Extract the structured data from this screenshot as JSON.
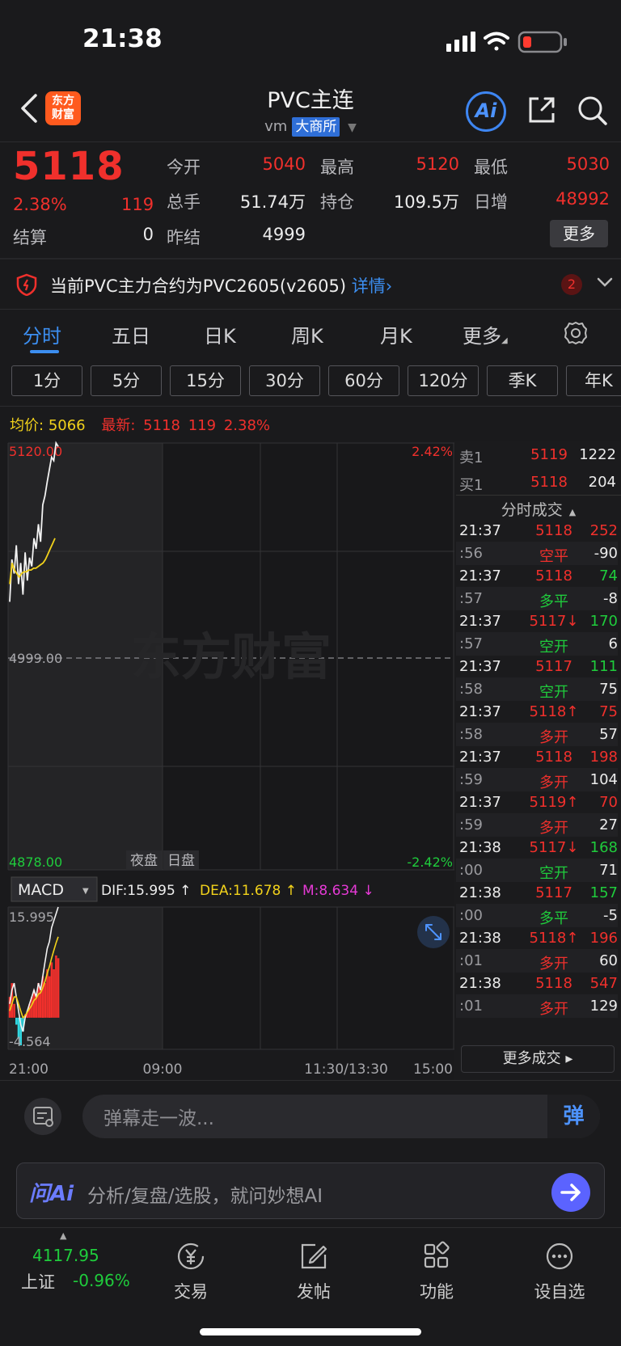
{
  "status": {
    "time": "21:38"
  },
  "header": {
    "logo_text_1": "东方",
    "logo_text_2": "财富",
    "title": "PVC主连",
    "sub_code": "vm",
    "exchange": "大商所",
    "ai_label": "Ai"
  },
  "quote": {
    "last": "5118",
    "change_pct": "2.38%",
    "change": "119",
    "settle_label": "结算",
    "settle": "0",
    "open_label": "今开",
    "open": "5040",
    "high_label": "最高",
    "high": "5120",
    "low_label": "最低",
    "low": "5030",
    "volume_label": "总手",
    "volume": "51.74万",
    "oi_label": "持仓",
    "oi": "109.5万",
    "daily_inc_label": "日增",
    "daily_inc": "48992",
    "prev_settle_label": "昨结",
    "prev_settle": "4999",
    "more_label": "更多"
  },
  "notice": {
    "text": "当前PVC主力合约为PVC2605(v2605)",
    "link": "详情›",
    "count": "2"
  },
  "period_tabs": [
    "分时",
    "五日",
    "日K",
    "周K",
    "月K",
    "更多"
  ],
  "minute_tabs": [
    "1分",
    "5分",
    "15分",
    "30分",
    "60分",
    "120分",
    "季K",
    "年K"
  ],
  "chart_header": {
    "avg_label": "均价:",
    "avg_value": "5066",
    "latest_label": "最新:",
    "latest_value": "5118",
    "latest_change": "119",
    "latest_pct": "2.38%"
  },
  "chart_data": [
    {
      "type": "line",
      "axis_left": [
        "5120.00",
        "4999.00",
        "4878.00"
      ],
      "axis_right": [
        "2.42%",
        "-2.42%"
      ],
      "session_labels": [
        "夜盘",
        "日盘"
      ],
      "watermark": "东方财富",
      "ylim": [
        4878,
        5120
      ],
      "baseline": 4999,
      "x_ticks": [
        "21:00",
        "09:00",
        "11:30/13:30",
        "15:00"
      ],
      "series": [
        {
          "values": [
            5030,
            5054,
            5046,
            5062,
            5040,
            5052,
            5034,
            5058,
            5042,
            5055,
            5050,
            5066,
            5060,
            5074,
            5064,
            5085,
            5090,
            5098,
            5105,
            5112,
            5110,
            5120,
            5118
          ]
        },
        {
          "values": [
            5040,
            5052,
            5048,
            5046,
            5044,
            5046,
            5047,
            5047,
            5048,
            5048,
            5049,
            5049,
            5050,
            5051,
            5052,
            5054,
            5057,
            5060,
            5063,
            5066
          ]
        }
      ]
    },
    {
      "type": "bar",
      "indicator": "MACD",
      "dif_label": "DIF:15.995 ↑",
      "dea_label": "DEA:11.678 ↑",
      "m_label": "M:8.634 ↓",
      "ylim": [
        -4.564,
        15.995
      ],
      "axis_labels": [
        "15.995",
        "-4.564"
      ],
      "hist": [
        3,
        5,
        2,
        -1,
        -3,
        -4,
        -2,
        0.5,
        1,
        2,
        3,
        4,
        3,
        5,
        4,
        6,
        5,
        7,
        6,
        8,
        7,
        9,
        8.6
      ],
      "series": [
        {
          "values": [
            2,
            4,
            5,
            3,
            1,
            -1,
            -2,
            0,
            1,
            2,
            3,
            4,
            3,
            5,
            4,
            6,
            8,
            10,
            11,
            13,
            14,
            15,
            16
          ]
        },
        {
          "values": [
            1,
            2,
            3,
            3,
            2,
            1,
            0,
            0.3,
            0.8,
            1.3,
            1.8,
            2.5,
            2.8,
            3.4,
            3.6,
            4.3,
            5.2,
            6.4,
            7.4,
            8.6,
            9.7,
            10.8,
            11.7
          ]
        }
      ]
    }
  ],
  "orderbook": {
    "ask_label": "卖1",
    "ask_price": "5119",
    "ask_qty": "1222",
    "bid_label": "买1",
    "bid_price": "5118",
    "bid_qty": "204",
    "ticks_title": "分时成交"
  },
  "ticks": [
    {
      "t": "21:37",
      "p": "5118",
      "pc": "red",
      "v": "252",
      "vc": "red"
    },
    {
      "t": ":56",
      "p": "空平",
      "pc": "red",
      "v": "-90",
      "vc": "white"
    },
    {
      "t": "21:37",
      "p": "5118",
      "pc": "red",
      "v": "74",
      "vc": "green"
    },
    {
      "t": ":57",
      "p": "多平",
      "pc": "green",
      "v": "-8",
      "vc": "white"
    },
    {
      "t": "21:37",
      "p": "5117↓",
      "pc": "red",
      "v": "170",
      "vc": "green"
    },
    {
      "t": ":57",
      "p": "空开",
      "pc": "green",
      "v": "6",
      "vc": "white"
    },
    {
      "t": "21:37",
      "p": "5117",
      "pc": "red",
      "v": "111",
      "vc": "green"
    },
    {
      "t": ":58",
      "p": "空开",
      "pc": "green",
      "v": "75",
      "vc": "white"
    },
    {
      "t": "21:37",
      "p": "5118↑",
      "pc": "red",
      "v": "75",
      "vc": "red"
    },
    {
      "t": ":58",
      "p": "多开",
      "pc": "red",
      "v": "57",
      "vc": "white"
    },
    {
      "t": "21:37",
      "p": "5118",
      "pc": "red",
      "v": "198",
      "vc": "red"
    },
    {
      "t": ":59",
      "p": "多开",
      "pc": "red",
      "v": "104",
      "vc": "white"
    },
    {
      "t": "21:37",
      "p": "5119↑",
      "pc": "red",
      "v": "70",
      "vc": "red"
    },
    {
      "t": ":59",
      "p": "多开",
      "pc": "red",
      "v": "27",
      "vc": "white"
    },
    {
      "t": "21:38",
      "p": "5117↓",
      "pc": "red",
      "v": "168",
      "vc": "green"
    },
    {
      "t": ":00",
      "p": "空开",
      "pc": "green",
      "v": "71",
      "vc": "white"
    },
    {
      "t": "21:38",
      "p": "5117",
      "pc": "red",
      "v": "157",
      "vc": "green"
    },
    {
      "t": ":00",
      "p": "多平",
      "pc": "green",
      "v": "-5",
      "vc": "white"
    },
    {
      "t": "21:38",
      "p": "5118↑",
      "pc": "red",
      "v": "196",
      "vc": "red"
    },
    {
      "t": ":01",
      "p": "多开",
      "pc": "red",
      "v": "60",
      "vc": "white"
    },
    {
      "t": "21:38",
      "p": "5118",
      "pc": "red",
      "v": "547",
      "vc": "red"
    },
    {
      "t": ":01",
      "p": "多开",
      "pc": "red",
      "v": "129",
      "vc": "white"
    }
  ],
  "more_trades": "更多成交 ▸",
  "danmaku": {
    "placeholder": "弹幕走一波...",
    "send": "弹"
  },
  "askai": {
    "logo": "问Ai",
    "placeholder": "分析/复盘/选股，就问妙想AI"
  },
  "bottom_nav": {
    "index_value": "4117.95",
    "index_name": "上证",
    "index_change": "-0.96%",
    "items": [
      "交易",
      "发帖",
      "功能",
      "设自选"
    ]
  },
  "colors": {
    "up": "#f0302c",
    "down": "#1fcc3c",
    "accent": "#3c8ef0",
    "avg": "#f2d21b"
  }
}
